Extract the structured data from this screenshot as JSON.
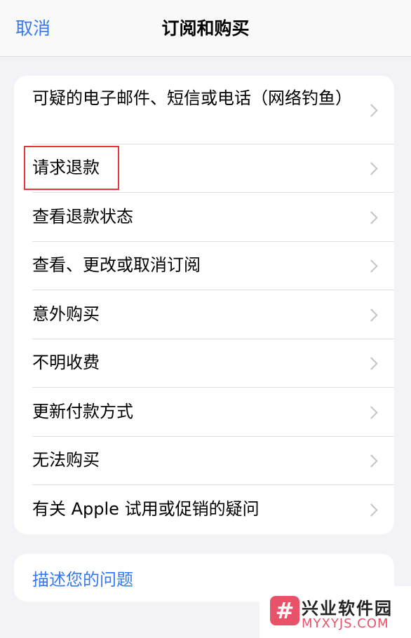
{
  "header": {
    "cancel_label": "取消",
    "title": "订阅和购买"
  },
  "menu": {
    "items": [
      {
        "label": "可疑的电子邮件、短信或电话（网络钓鱼）"
      },
      {
        "label": "请求退款"
      },
      {
        "label": "查看退款状态"
      },
      {
        "label": "查看、更改或取消订阅"
      },
      {
        "label": "意外购买"
      },
      {
        "label": "不明收费"
      },
      {
        "label": "更新付款方式"
      },
      {
        "label": "无法购买"
      },
      {
        "label": "有关 Apple 试用或促销的疑问"
      }
    ]
  },
  "describe": {
    "label": "描述您的问题"
  },
  "watermark": {
    "logo_glyph": "#",
    "title": "兴业软件园",
    "domain": "MYXYJS.COM"
  },
  "colors": {
    "accent": "#3478f6",
    "highlight": "#e8353b",
    "background": "#f2f2f7"
  }
}
